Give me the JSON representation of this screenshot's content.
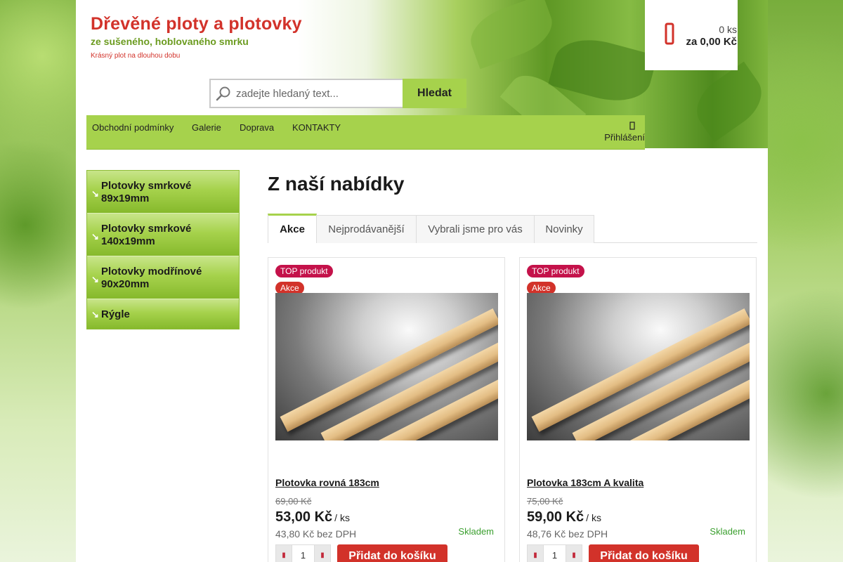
{
  "brand": {
    "title": "Dřevěné ploty a plotovky",
    "subtitle": "ze sušeného, hoblovaného smrku",
    "tagline": "Krásný plot na dlouhou dobu"
  },
  "search": {
    "placeholder": "zadejte hledaný text...",
    "button_label": "Hledat"
  },
  "cart": {
    "icon": "cart-icon",
    "count": "0 ks",
    "total": "za 0,00 Kč"
  },
  "nav": {
    "items": [
      {
        "label": "Obchodní podmínky"
      },
      {
        "label": "Galerie"
      },
      {
        "label": "Doprava"
      },
      {
        "label": "KONTAKTY"
      }
    ],
    "login": {
      "icon": "user-icon",
      "label": "Přihlášení"
    }
  },
  "categories": [
    {
      "label": "Plotovky smrkové 89x19mm"
    },
    {
      "label": "Plotovky smrkové 140x19mm"
    },
    {
      "label": "Plotovky modřínové 90x20mm"
    },
    {
      "label": "Rýgle"
    }
  ],
  "main": {
    "title": "Z naší nabídky",
    "tabs": [
      {
        "label": "Akce",
        "active": true
      },
      {
        "label": "Nejprodávanější",
        "active": false
      },
      {
        "label": "Vybrali jsme pro vás",
        "active": false
      },
      {
        "label": "Novinky",
        "active": false
      }
    ]
  },
  "products": [
    {
      "flag_top": "TOP produkt",
      "flag_sale": "Akce",
      "name": "Plotovka rovná 183cm",
      "old_price": "69,00 Kč",
      "price": "53,00 Kč",
      "unit": "/ ks",
      "net_price": "43,80 Kč bez DPH",
      "stock": "Skladem",
      "quantity": "1",
      "add_label": "Přidat do košíku"
    },
    {
      "flag_top": "TOP produkt",
      "flag_sale": "Akce",
      "name": "Plotovka 183cm A kvalita",
      "old_price": "75,00 Kč",
      "price": "59,00 Kč",
      "unit": "/ ks",
      "net_price": "48,76 Kč bez DPH",
      "stock": "Skladem",
      "quantity": "1",
      "add_label": "Přidat do košíku"
    }
  ],
  "colors": {
    "accent_green": "#a6d24c",
    "brand_red": "#d2322a",
    "top_badge": "#c4124a",
    "stock_green": "#3a9f2e"
  }
}
